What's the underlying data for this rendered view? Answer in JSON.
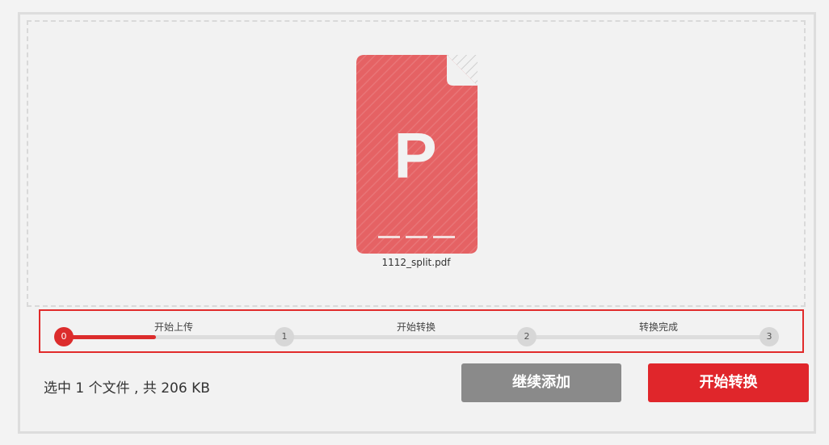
{
  "file": {
    "name": "1112_split.pdf",
    "icon_letter": "P",
    "icon": "pdf-file-icon",
    "icon_color": "#e56264"
  },
  "progress": {
    "fraction": 0.13,
    "steps": [
      {
        "number": "0",
        "label": "开始上传"
      },
      {
        "number": "1",
        "label": "开始转换"
      },
      {
        "number": "2",
        "label": "转换完成"
      },
      {
        "number": "3"
      }
    ]
  },
  "summary": "选中 1 个文件 , 共 206 KB",
  "buttons": {
    "add": "继续添加",
    "start": "开始转换"
  },
  "colors": {
    "accent": "#e0262b",
    "secondary": "#8a8a8a"
  }
}
